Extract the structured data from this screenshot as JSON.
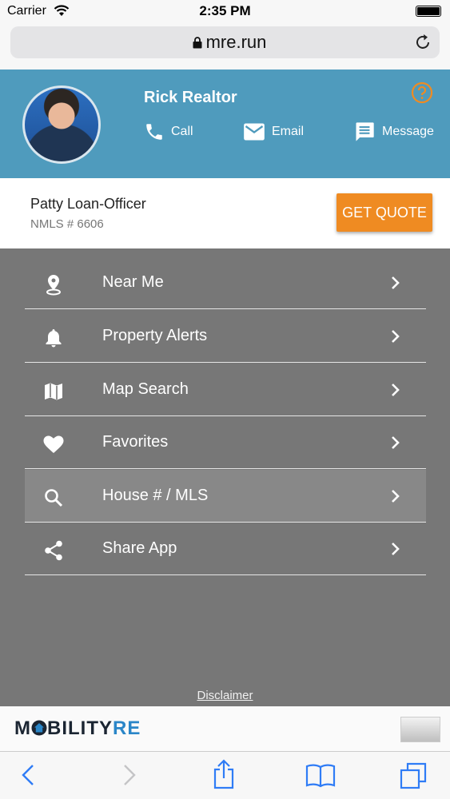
{
  "status_bar": {
    "carrier": "Carrier",
    "time": "2:35 PM"
  },
  "browser": {
    "url": "mre.run"
  },
  "agent": {
    "name": "Rick Realtor",
    "actions": {
      "call": "Call",
      "email": "Email",
      "message": "Message"
    }
  },
  "loan_officer": {
    "name": "Patty Loan-Officer",
    "nmls": "NMLS # 6606",
    "quote_label": "GET QUOTE"
  },
  "menu": {
    "items": [
      {
        "label": "Near Me",
        "icon": "location-pin-icon"
      },
      {
        "label": "Property Alerts",
        "icon": "bell-icon"
      },
      {
        "label": "Map Search",
        "icon": "map-icon"
      },
      {
        "label": "Favorites",
        "icon": "heart-icon"
      },
      {
        "label": "House # / MLS",
        "icon": "search-icon",
        "active": true
      },
      {
        "label": "Share App",
        "icon": "share-icon"
      }
    ],
    "disclaimer": "Disclaimer"
  },
  "brand": {
    "logo_main": "M",
    "logo_mid": "BILITY",
    "logo_re": "RE"
  },
  "colors": {
    "header": "#4f9bbd",
    "accent": "#ef8b22",
    "menu_bg": "#777777",
    "logo_blue": "#2a86c8"
  }
}
